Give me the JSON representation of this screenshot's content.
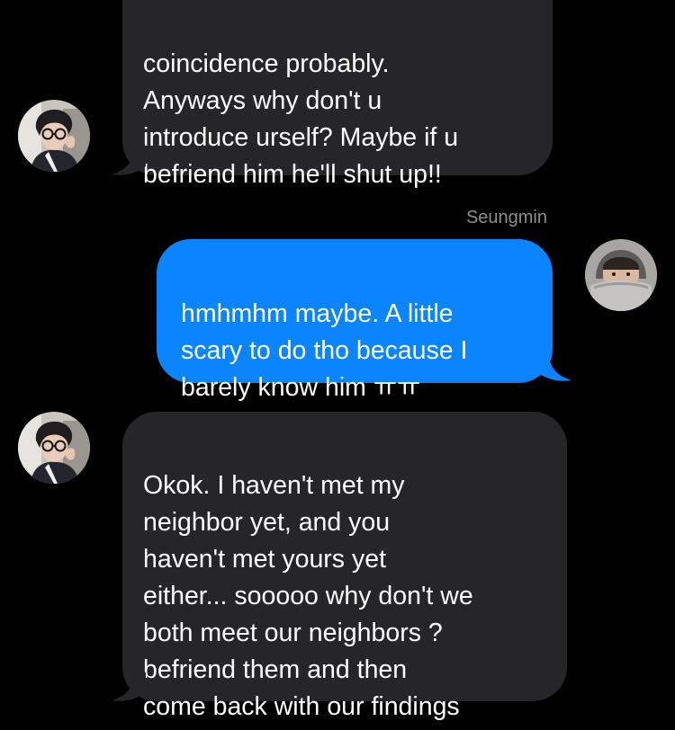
{
  "conversation": {
    "messages": [
      {
        "direction": "incoming",
        "text": "coincidence probably.\nAnyways why don't u\nintroduce urself? Maybe if u\nbefriend him he'll shut up!!",
        "avatar": "person-photo-glasses"
      },
      {
        "direction": "outgoing",
        "sender_name": "Seungmin",
        "text": "hmhmhm maybe. A little\nscary to do tho because I\nbarely know him ㅠㅠ",
        "avatar": "person-photo-hoodie"
      },
      {
        "direction": "incoming",
        "text": "Okok. I haven't met my\nneighbor yet, and you\nhaven't met yours yet\neither... sooooo why don't we\nboth meet our neighbors ?\nbefriend them and then\ncome back with our findings",
        "avatar": "person-photo-glasses"
      }
    ]
  },
  "colors": {
    "background": "#000000",
    "incoming_bubble": "#262629",
    "outgoing_bubble": "#0a84ff",
    "message_text": "#ffffff",
    "sender_name": "#8e8e93"
  }
}
